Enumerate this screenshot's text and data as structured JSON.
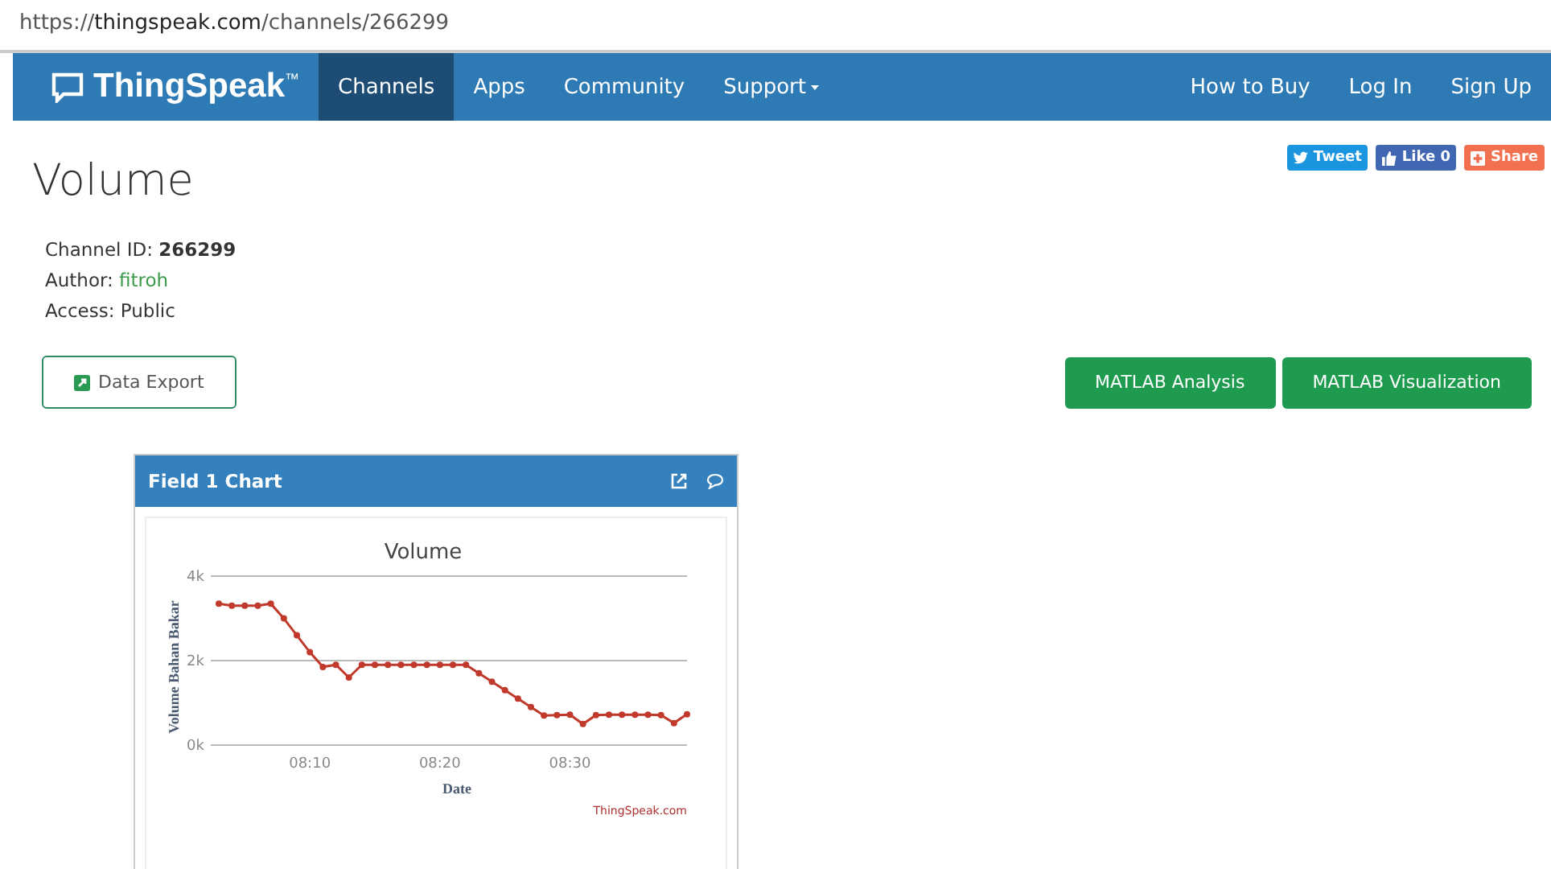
{
  "address_bar": {
    "url_prefix": "https://",
    "url_host": "thingspeak.com",
    "url_path": "/channels/266299"
  },
  "navbar": {
    "brand": "ThingSpeak",
    "trademark": "™",
    "items": [
      {
        "label": "Channels",
        "selected": true,
        "dropdown": false
      },
      {
        "label": "Apps",
        "selected": false,
        "dropdown": false
      },
      {
        "label": "Community",
        "selected": false,
        "dropdown": false
      },
      {
        "label": "Support",
        "selected": false,
        "dropdown": true
      }
    ],
    "right_items": [
      "How to Buy",
      "Log In",
      "Sign Up"
    ]
  },
  "social": [
    {
      "kind": "tweet",
      "label": "Tweet",
      "color": "#1b95e0"
    },
    {
      "kind": "like",
      "label": "Like 0",
      "color": "#4267b2"
    },
    {
      "kind": "share",
      "label": "Share",
      "color": "#f0704f"
    }
  ],
  "channel": {
    "title": "Volume",
    "id_label": "Channel ID:",
    "id": "266299",
    "author_label": "Author:",
    "author": "fitroh",
    "access_label": "Access:",
    "access": "Public"
  },
  "export_button": "Data Export",
  "actions": [
    "MATLAB Analysis",
    "MATLAB Visualization"
  ],
  "chart_card": {
    "title": "Field 1 Chart",
    "credit": "ThingSpeak.com",
    "chart_data": {
      "type": "line",
      "title": "Volume",
      "xlabel": "Date",
      "ylabel": "Volume Bahan Bakar",
      "categories": [
        null,
        null,
        null,
        null,
        null,
        null,
        null,
        "08:10",
        null,
        null,
        null,
        null,
        null,
        null,
        null,
        null,
        null,
        "08:20",
        null,
        null,
        null,
        null,
        null,
        null,
        null,
        null,
        null,
        "08:30",
        null,
        null,
        null,
        null,
        null,
        null,
        null,
        null,
        null
      ],
      "series": [
        {
          "color": "#c0392b",
          "marker": "circle",
          "values": [
            3350,
            3300,
            3300,
            3300,
            3350,
            3000,
            2600,
            2200,
            1850,
            1900,
            1600,
            1900,
            1900,
            1900,
            1900,
            1900,
            1900,
            1900,
            1900,
            1900,
            1700,
            1500,
            1300,
            1100,
            900,
            700,
            710,
            720,
            500,
            710,
            720,
            720,
            720,
            720,
            710,
            520,
            730
          ]
        }
      ],
      "ylim": [
        0,
        4000
      ],
      "yticks": [
        {
          "value": 0,
          "label": "0k"
        },
        {
          "value": 2000,
          "label": "2k"
        },
        {
          "value": 4000,
          "label": "4k"
        }
      ]
    }
  }
}
